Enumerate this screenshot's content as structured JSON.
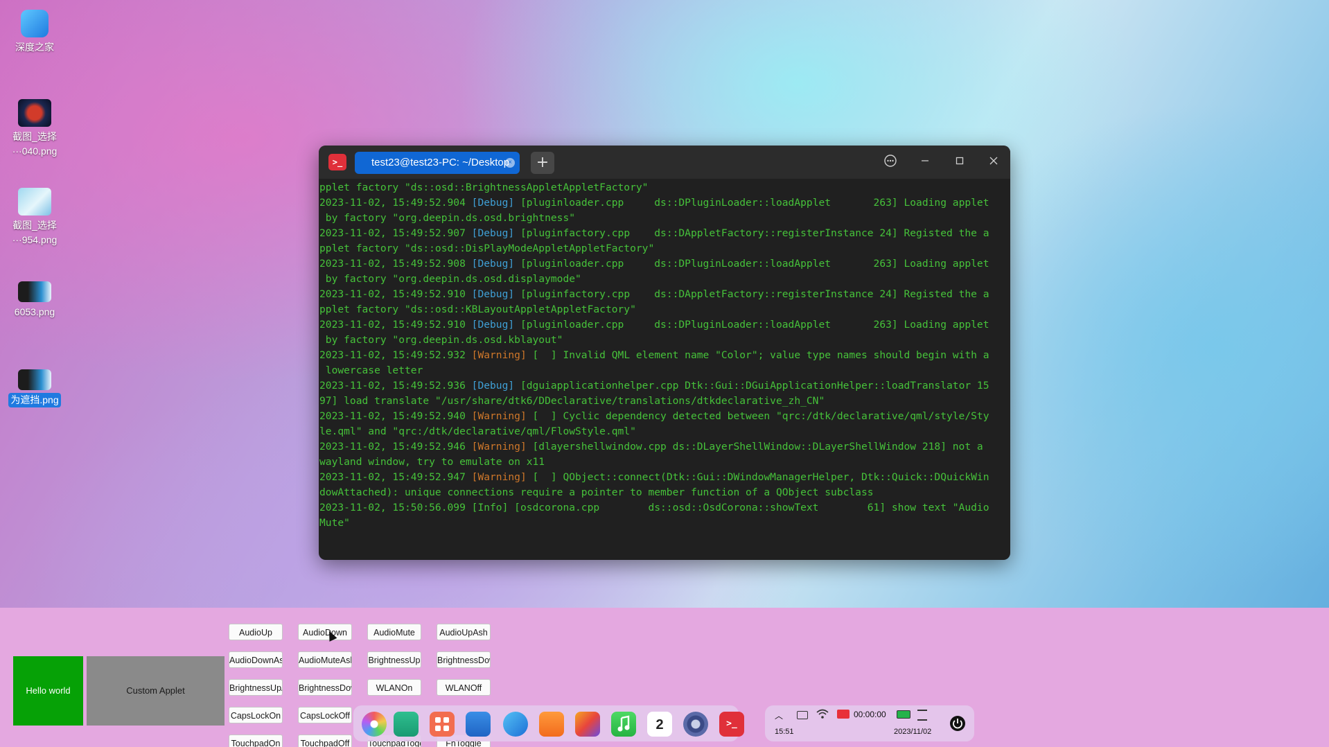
{
  "desktop": {
    "icons": [
      {
        "line1": "深度之家",
        "line2": ""
      },
      {
        "line1": "截图_选择",
        "line2": "···040.png"
      },
      {
        "line1": "截图_选择",
        "line2": "···954.png"
      },
      {
        "line1": "6053.png",
        "line2": ""
      },
      {
        "line1": "为遮挡.png",
        "line2": ""
      }
    ]
  },
  "terminal": {
    "tab_title": "test23@test23-PC: ~/Desktop",
    "add_tab_label": "+",
    "lines": [
      [
        {
          "t": "pplet factory \"ds::osd::BrightnessAppletAppletFactory\"",
          "c": "text"
        }
      ],
      [
        {
          "t": "2023-11-02, 15:49:52.904 ",
          "c": "text"
        },
        {
          "t": "[Debug]",
          "c": "debug"
        },
        {
          "t": " [pluginloader.cpp     ds::DPluginLoader::loadApplet       263] Loading applet",
          "c": "text"
        }
      ],
      [
        {
          "t": " by factory \"org.deepin.ds.osd.brightness\"",
          "c": "text"
        }
      ],
      [
        {
          "t": "2023-11-02, 15:49:52.907 ",
          "c": "text"
        },
        {
          "t": "[Debug]",
          "c": "debug"
        },
        {
          "t": " [pluginfactory.cpp    ds::DAppletFactory::registerInstance 24] Registed the a",
          "c": "text"
        }
      ],
      [
        {
          "t": "pplet factory \"ds::osd::DisPlayModeAppletAppletFactory\"",
          "c": "text"
        }
      ],
      [
        {
          "t": "2023-11-02, 15:49:52.908 ",
          "c": "text"
        },
        {
          "t": "[Debug]",
          "c": "debug"
        },
        {
          "t": " [pluginloader.cpp     ds::DPluginLoader::loadApplet       263] Loading applet",
          "c": "text"
        }
      ],
      [
        {
          "t": " by factory \"org.deepin.ds.osd.displaymode\"",
          "c": "text"
        }
      ],
      [
        {
          "t": "2023-11-02, 15:49:52.910 ",
          "c": "text"
        },
        {
          "t": "[Debug]",
          "c": "debug"
        },
        {
          "t": " [pluginfactory.cpp    ds::DAppletFactory::registerInstance 24] Registed the a",
          "c": "text"
        }
      ],
      [
        {
          "t": "pplet factory \"ds::osd::KBLayoutAppletAppletFactory\"",
          "c": "text"
        }
      ],
      [
        {
          "t": "2023-11-02, 15:49:52.910 ",
          "c": "text"
        },
        {
          "t": "[Debug]",
          "c": "debug"
        },
        {
          "t": " [pluginloader.cpp     ds::DPluginLoader::loadApplet       263] Loading applet",
          "c": "text"
        }
      ],
      [
        {
          "t": " by factory \"org.deepin.ds.osd.kblayout\"",
          "c": "text"
        }
      ],
      [
        {
          "t": "2023-11-02, 15:49:52.932 ",
          "c": "text"
        },
        {
          "t": "[Warning]",
          "c": "warning"
        },
        {
          "t": " [  ] Invalid QML element name \"Color\"; value type names should begin with a",
          "c": "text"
        }
      ],
      [
        {
          "t": " lowercase letter",
          "c": "text"
        }
      ],
      [
        {
          "t": "2023-11-02, 15:49:52.936 ",
          "c": "text"
        },
        {
          "t": "[Debug]",
          "c": "debug"
        },
        {
          "t": " [dguiapplicationhelper.cpp Dtk::Gui::DGuiApplicationHelper::loadTranslator 15",
          "c": "text"
        }
      ],
      [
        {
          "t": "97] load translate \"/usr/share/dtk6/DDeclarative/translations/dtkdeclarative_zh_CN\"",
          "c": "text"
        }
      ],
      [
        {
          "t": "2023-11-02, 15:49:52.940 ",
          "c": "text"
        },
        {
          "t": "[Warning]",
          "c": "warning"
        },
        {
          "t": " [  ] Cyclic dependency detected between \"qrc:/dtk/declarative/qml/style/Sty",
          "c": "text"
        }
      ],
      [
        {
          "t": "le.qml\" and \"qrc:/dtk/declarative/qml/FlowStyle.qml\"",
          "c": "text"
        }
      ],
      [
        {
          "t": "2023-11-02, 15:49:52.946 ",
          "c": "text"
        },
        {
          "t": "[Warning]",
          "c": "warning"
        },
        {
          "t": " [dlayershellwindow.cpp ds::DLayerShellWindow::DLayerShellWindow 218] not a",
          "c": "text"
        }
      ],
      [
        {
          "t": "wayland window, try to emulate on x11",
          "c": "text"
        }
      ],
      [
        {
          "t": "2023-11-02, 15:49:52.947 ",
          "c": "text"
        },
        {
          "t": "[Warning]",
          "c": "warning"
        },
        {
          "t": " [  ] QObject::connect(Dtk::Gui::DWindowManagerHelper, Dtk::Quick::DQuickWin",
          "c": "text"
        }
      ],
      [
        {
          "t": "dowAttached): unique connections require a pointer to member function of a QObject subclass",
          "c": "text"
        }
      ],
      [
        {
          "t": "2023-11-02, 15:50:56.099 [Info] [osdcorona.cpp        ds::osd::OsdCorona::showText        61] show text \"Audio",
          "c": "text"
        }
      ],
      [
        {
          "t": "Mute\"",
          "c": "text"
        }
      ]
    ]
  },
  "panel": {
    "buttons": [
      [
        "AudioUp",
        "AudioDown",
        "AudioMute",
        "AudioUpAsh"
      ],
      [
        "AudioDownAsh",
        "AudioMuteAsh",
        "BrightnessUp",
        "BrightnessDown"
      ],
      [
        "BrightnessUpAsh",
        "BrightnessDownA",
        "WLANOn",
        "WLANOff"
      ],
      [
        "CapsLockOn",
        "CapsLockOff",
        "",
        ""
      ],
      [
        "TouchpadOn",
        "TouchpadOff",
        "TouchpadToggle",
        "FnToggle"
      ]
    ],
    "hello_label": "Hello world",
    "custom_label": "Custom Applet"
  },
  "dock": {
    "apps": [
      "launcher",
      "multitasking-view",
      "app-store-grid",
      "file-manager",
      "browser",
      "app-store",
      "image-viewer",
      "music",
      "calendar",
      "control-center",
      "terminal"
    ],
    "calendar_day": "2"
  },
  "tray": {
    "record_time": "00:00:00",
    "time": "15:51",
    "date": "2023/11/02"
  }
}
